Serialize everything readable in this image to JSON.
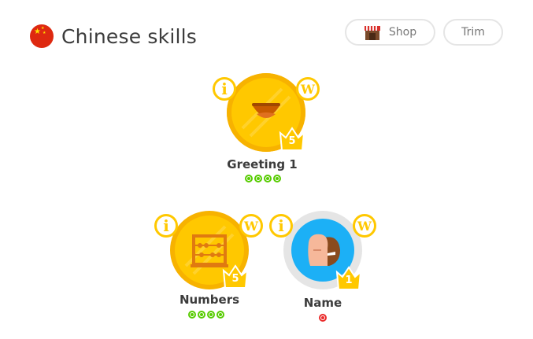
{
  "header": {
    "title": "Chinese skills",
    "flag_icon": "china-flag-icon"
  },
  "buttons": {
    "shop_label": "Shop",
    "trim_label": "Trim"
  },
  "skills": [
    {
      "name": "Greeting 1",
      "crown_level": "5",
      "icon": "smile-icon",
      "info_glyph": "i",
      "words_glyph": "W",
      "strength": [
        "green",
        "green",
        "green",
        "green"
      ]
    },
    {
      "name": "Numbers",
      "crown_level": "5",
      "icon": "abacus-icon",
      "info_glyph": "i",
      "words_glyph": "W",
      "strength": [
        "green",
        "green",
        "green",
        "green"
      ]
    },
    {
      "name": "Name",
      "crown_level": "1",
      "icon": "two-faces-icon",
      "info_glyph": "i",
      "words_glyph": "W",
      "strength": [
        "red"
      ]
    }
  ],
  "colors": {
    "gold": "#ffc800",
    "gold_dark": "#f0a500",
    "blue": "#1cb0f6",
    "green": "#58cc02",
    "red": "#ea2b2b"
  }
}
